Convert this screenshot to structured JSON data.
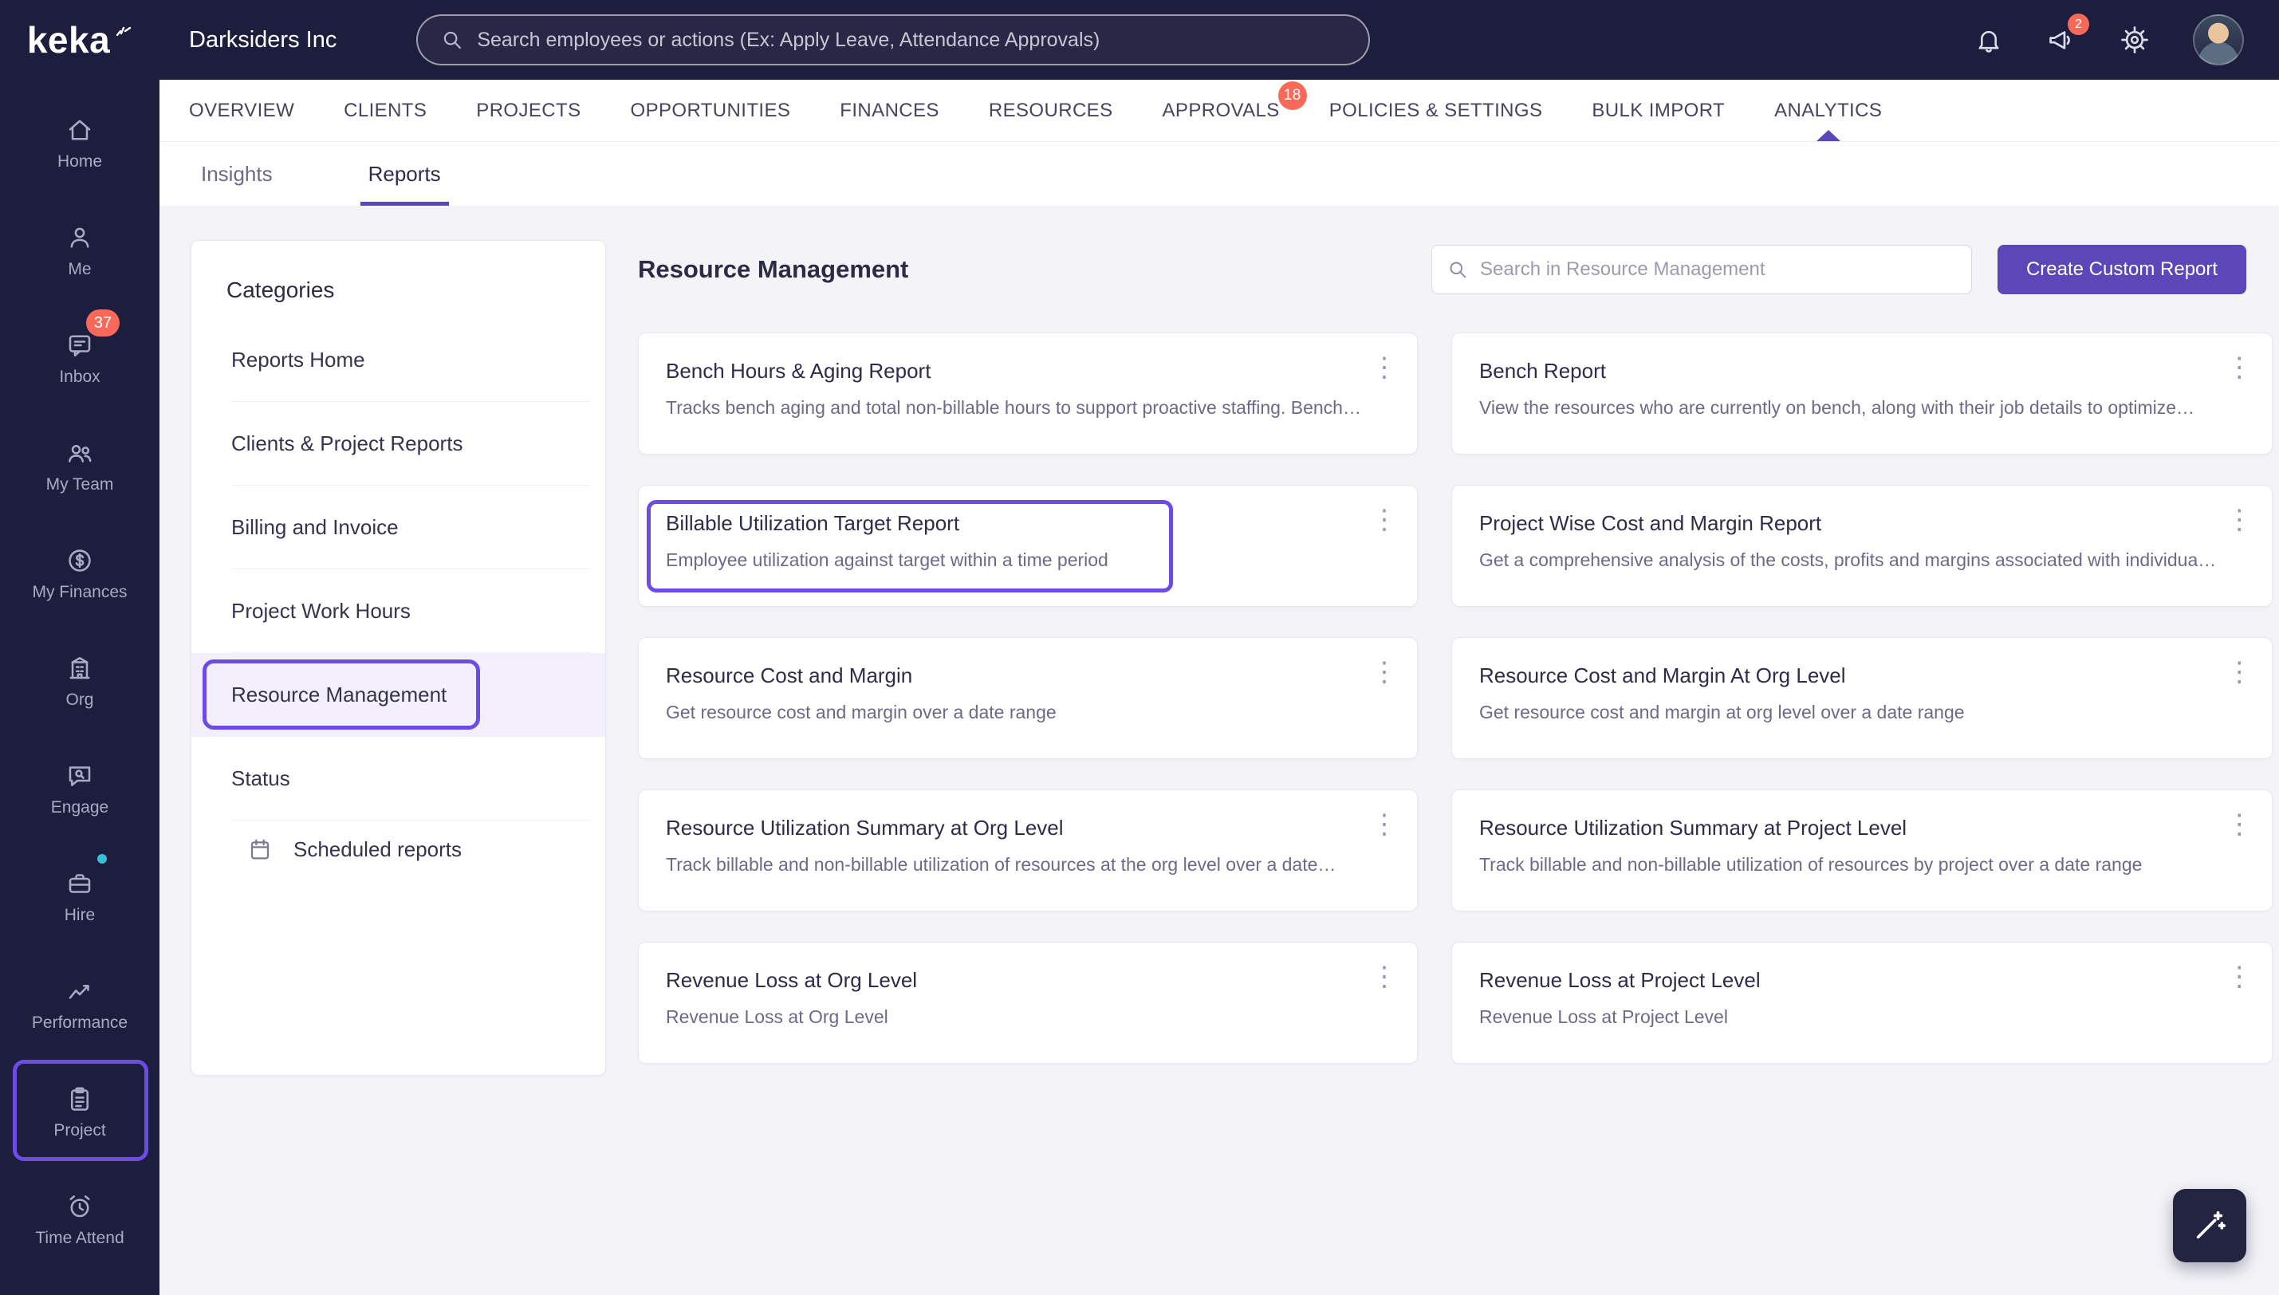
{
  "brand": {
    "logo_text": "keka",
    "company": "Darksiders Inc"
  },
  "header": {
    "search_placeholder": "Search employees or actions (Ex: Apply Leave, Attendance Approvals)",
    "announcement_badge": "2"
  },
  "nav": {
    "tabs": [
      {
        "label": "OVERVIEW"
      },
      {
        "label": "CLIENTS"
      },
      {
        "label": "PROJECTS"
      },
      {
        "label": "OPPORTUNITIES"
      },
      {
        "label": "FINANCES"
      },
      {
        "label": "RESOURCES"
      },
      {
        "label": "APPROVALS",
        "badge": "18"
      },
      {
        "label": "POLICIES & SETTINGS"
      },
      {
        "label": "BULK IMPORT"
      },
      {
        "label": "ANALYTICS",
        "active": true
      }
    ],
    "subtabs": [
      {
        "label": "Insights"
      },
      {
        "label": "Reports",
        "active": true
      }
    ]
  },
  "sidebar": {
    "items": [
      {
        "label": "Home"
      },
      {
        "label": "Me"
      },
      {
        "label": "Inbox",
        "badge": "37"
      },
      {
        "label": "My Team"
      },
      {
        "label": "My Finances"
      },
      {
        "label": "Org"
      },
      {
        "label": "Engage"
      },
      {
        "label": "Hire",
        "dot": true
      },
      {
        "label": "Performance"
      },
      {
        "label": "Project",
        "highlighted": true
      },
      {
        "label": "Time Attend"
      }
    ]
  },
  "categories": {
    "title": "Categories",
    "items": [
      {
        "label": "Reports Home"
      },
      {
        "label": "Clients & Project Reports"
      },
      {
        "label": "Billing and Invoice"
      },
      {
        "label": "Project Work Hours"
      },
      {
        "label": "Resource Management",
        "selected": true,
        "highlighted": true
      },
      {
        "label": "Status"
      }
    ],
    "scheduled": "Scheduled reports"
  },
  "content": {
    "title": "Resource Management",
    "search_placeholder": "Search in Resource Management",
    "create_button": "Create Custom Report",
    "reports": [
      {
        "title": "Bench Hours & Aging Report",
        "desc": "Tracks bench aging and total non-billable hours to support proactive staffing. Bench…"
      },
      {
        "title": "Bench Report",
        "desc": "View the resources who are currently on bench, along with their job details to optimize…"
      },
      {
        "title": "Billable Utilization Target Report",
        "desc": "Employee utilization against target within a time period",
        "highlighted": true
      },
      {
        "title": "Project Wise Cost and Margin Report",
        "desc": "Get a comprehensive analysis of the costs, profits and margins associated with individua…"
      },
      {
        "title": "Resource Cost and Margin",
        "desc": "Get resource cost and margin over a date range"
      },
      {
        "title": "Resource Cost and Margin At Org Level",
        "desc": "Get resource cost and margin at org level over a date range"
      },
      {
        "title": "Resource Utilization Summary at Org Level",
        "desc": "Track billable and non-billable utilization of resources at the org level over a date…"
      },
      {
        "title": "Resource Utilization Summary at Project Level",
        "desc": "Track billable and non-billable utilization of resources by project over a date range"
      },
      {
        "title": "Revenue Loss at Org Level",
        "desc": "Revenue Loss at Org Level"
      },
      {
        "title": "Revenue Loss at Project Level",
        "desc": "Revenue Loss at Project Level"
      }
    ]
  },
  "icons": {
    "kebab": "⋮"
  },
  "colors": {
    "dark": "#1d1d3d",
    "accent": "#5b47b8",
    "annotation": "#6d4ce6",
    "badge": "#f9695a",
    "bg": "#f4f4f8",
    "border": "#e7e7ee",
    "selectedBg": "#f3effc"
  }
}
